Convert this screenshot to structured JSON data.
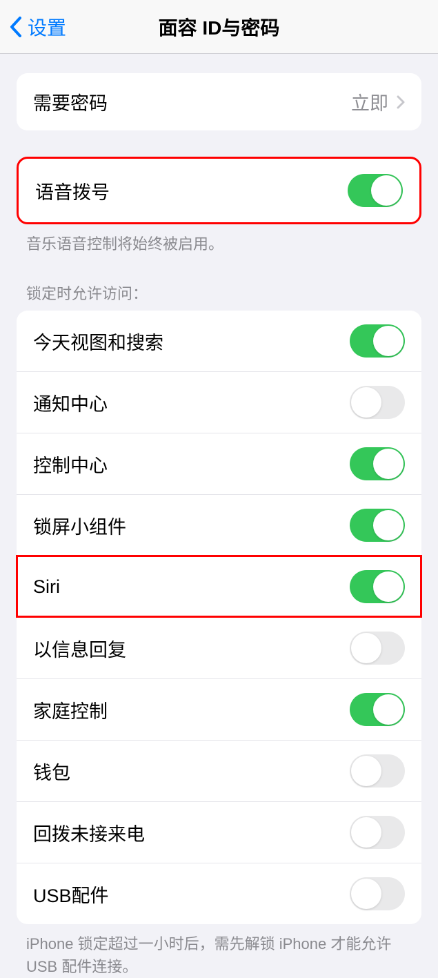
{
  "nav": {
    "back_label": "设置",
    "title": "面容 ID与密码"
  },
  "require_passcode": {
    "label": "需要密码",
    "value": "立即"
  },
  "voice_dial": {
    "label": "语音拨号",
    "on": true,
    "footer": "音乐语音控制将始终被启用。"
  },
  "lock_access": {
    "header": "锁定时允许访问：",
    "items": [
      {
        "label": "今天视图和搜索",
        "on": true
      },
      {
        "label": "通知中心",
        "on": false
      },
      {
        "label": "控制中心",
        "on": true
      },
      {
        "label": "锁屏小组件",
        "on": true
      },
      {
        "label": "Siri",
        "on": true,
        "highlight": true
      },
      {
        "label": "以信息回复",
        "on": false
      },
      {
        "label": "家庭控制",
        "on": true
      },
      {
        "label": "钱包",
        "on": false
      },
      {
        "label": "回拨未接来电",
        "on": false
      },
      {
        "label": "USB配件",
        "on": false
      }
    ],
    "footer": "iPhone 锁定超过一小时后，需先解锁 iPhone 才能允许USB 配件连接。"
  }
}
